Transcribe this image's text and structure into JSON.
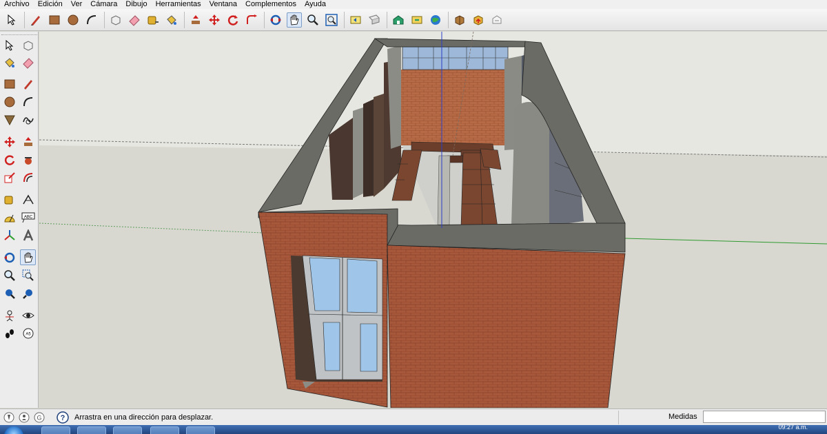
{
  "menu": {
    "items": [
      "Archivo",
      "Edición",
      "Ver",
      "Cámara",
      "Dibujo",
      "Herramientas",
      "Ventana",
      "Complementos",
      "Ayuda"
    ]
  },
  "toolbar": {
    "tools": [
      "select-icon",
      "pencil-icon",
      "rectangle-icon",
      "circle-icon",
      "arc-icon",
      "make-component-icon",
      "eraser-icon",
      "tape-measure-icon",
      "paint-bucket-icon",
      "push-pull-icon",
      "move-icon",
      "rotate-icon",
      "follow-me-icon",
      "orbit-icon",
      "pan-icon",
      "zoom-icon",
      "zoom-extents-icon",
      "previous-view-icon",
      "next-view-icon",
      "warehouse-icon",
      "share-model-icon",
      "google-earth-icon",
      "get-models-icon",
      "share-component-icon",
      "extension-warehouse-icon"
    ],
    "active_tool": "pan-icon"
  },
  "left_toolbar": {
    "tools": [
      "select-icon",
      "make-component-icon",
      "paint-bucket-icon",
      "eraser-icon",
      "rectangle-icon",
      "pencil-icon",
      "circle-icon",
      "arc-icon",
      "polygon-icon",
      "freehand-icon",
      "move-icon",
      "push-pull-icon",
      "rotate-icon",
      "follow-me-icon",
      "scale-icon",
      "offset-icon",
      "tape-measure-icon",
      "dimension-icon",
      "protractor-icon",
      "text-icon",
      "axes-icon",
      "3d-text-icon",
      "orbit-icon",
      "pan-icon",
      "zoom-icon",
      "zoom-window-icon",
      "zoom-extents-icon",
      "previous-icon",
      "position-camera-icon",
      "look-around-icon",
      "walk-icon",
      "section-plane-icon"
    ],
    "section_text_label": "ABC",
    "section_plane_label": "A5"
  },
  "status": {
    "message": "Arrastra en una dirección para desplazar.",
    "measure_label": "Medidas",
    "measure_value": ""
  },
  "taskbar": {
    "clock": "09:27 a.m."
  },
  "colors": {
    "brick": "#a8583a",
    "wall_top": "#6b6b66",
    "sky": "#e7e7e1",
    "ground": "#d8d8d0",
    "accent": "#3a6ea5"
  }
}
